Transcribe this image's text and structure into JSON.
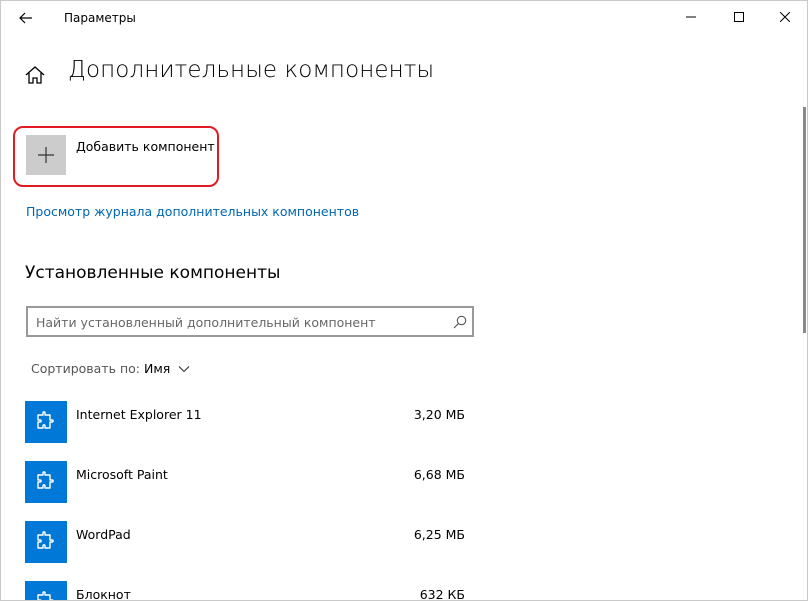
{
  "window": {
    "title": "Параметры"
  },
  "page": {
    "title": "Дополнительные компоненты"
  },
  "add_component": {
    "label": "Добавить компонент"
  },
  "history_link": {
    "label": "Просмотр журнала дополнительных компонентов"
  },
  "installed": {
    "title": "Установленные компоненты",
    "search": {
      "placeholder": "Найти установленный дополнительный компонент",
      "value": ""
    },
    "sort": {
      "label": "Сортировать по:",
      "value": "Имя"
    },
    "items": [
      {
        "name": "Internet Explorer 11",
        "size": "3,20 МБ",
        "icon": "puzzle-icon"
      },
      {
        "name": "Microsoft Paint",
        "size": "6,68 МБ",
        "icon": "puzzle-icon"
      },
      {
        "name": "WordPad",
        "size": "6,25 МБ",
        "icon": "puzzle-icon"
      },
      {
        "name": "Блокнот",
        "size": "632 КБ",
        "icon": "puzzle-icon"
      }
    ]
  },
  "colors": {
    "accent": "#0078d7",
    "link": "#0066b4",
    "highlight": "#e21b23",
    "add_button_bg": "#cccccc"
  }
}
